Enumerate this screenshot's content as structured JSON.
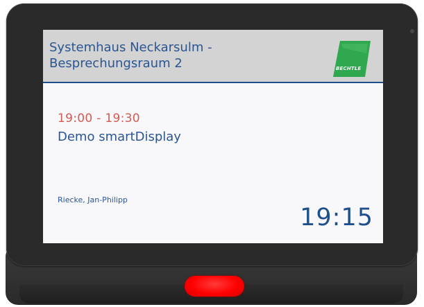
{
  "header": {
    "room_title": "Systemhaus Neckarsulm -\nBesprechungsraum 2",
    "logo_text": "BECHTLE"
  },
  "meeting": {
    "time_range": "19:00 - 19:30",
    "subject": "Demo smartDisplay",
    "organizer": "Riecke, Jan-Philipp"
  },
  "clock": {
    "current_time": "19:15"
  },
  "colors": {
    "accent_blue": "#2a5592",
    "time_red": "#d45a50",
    "logo_green": "#2fa84f",
    "led_red": "#ff0000"
  }
}
